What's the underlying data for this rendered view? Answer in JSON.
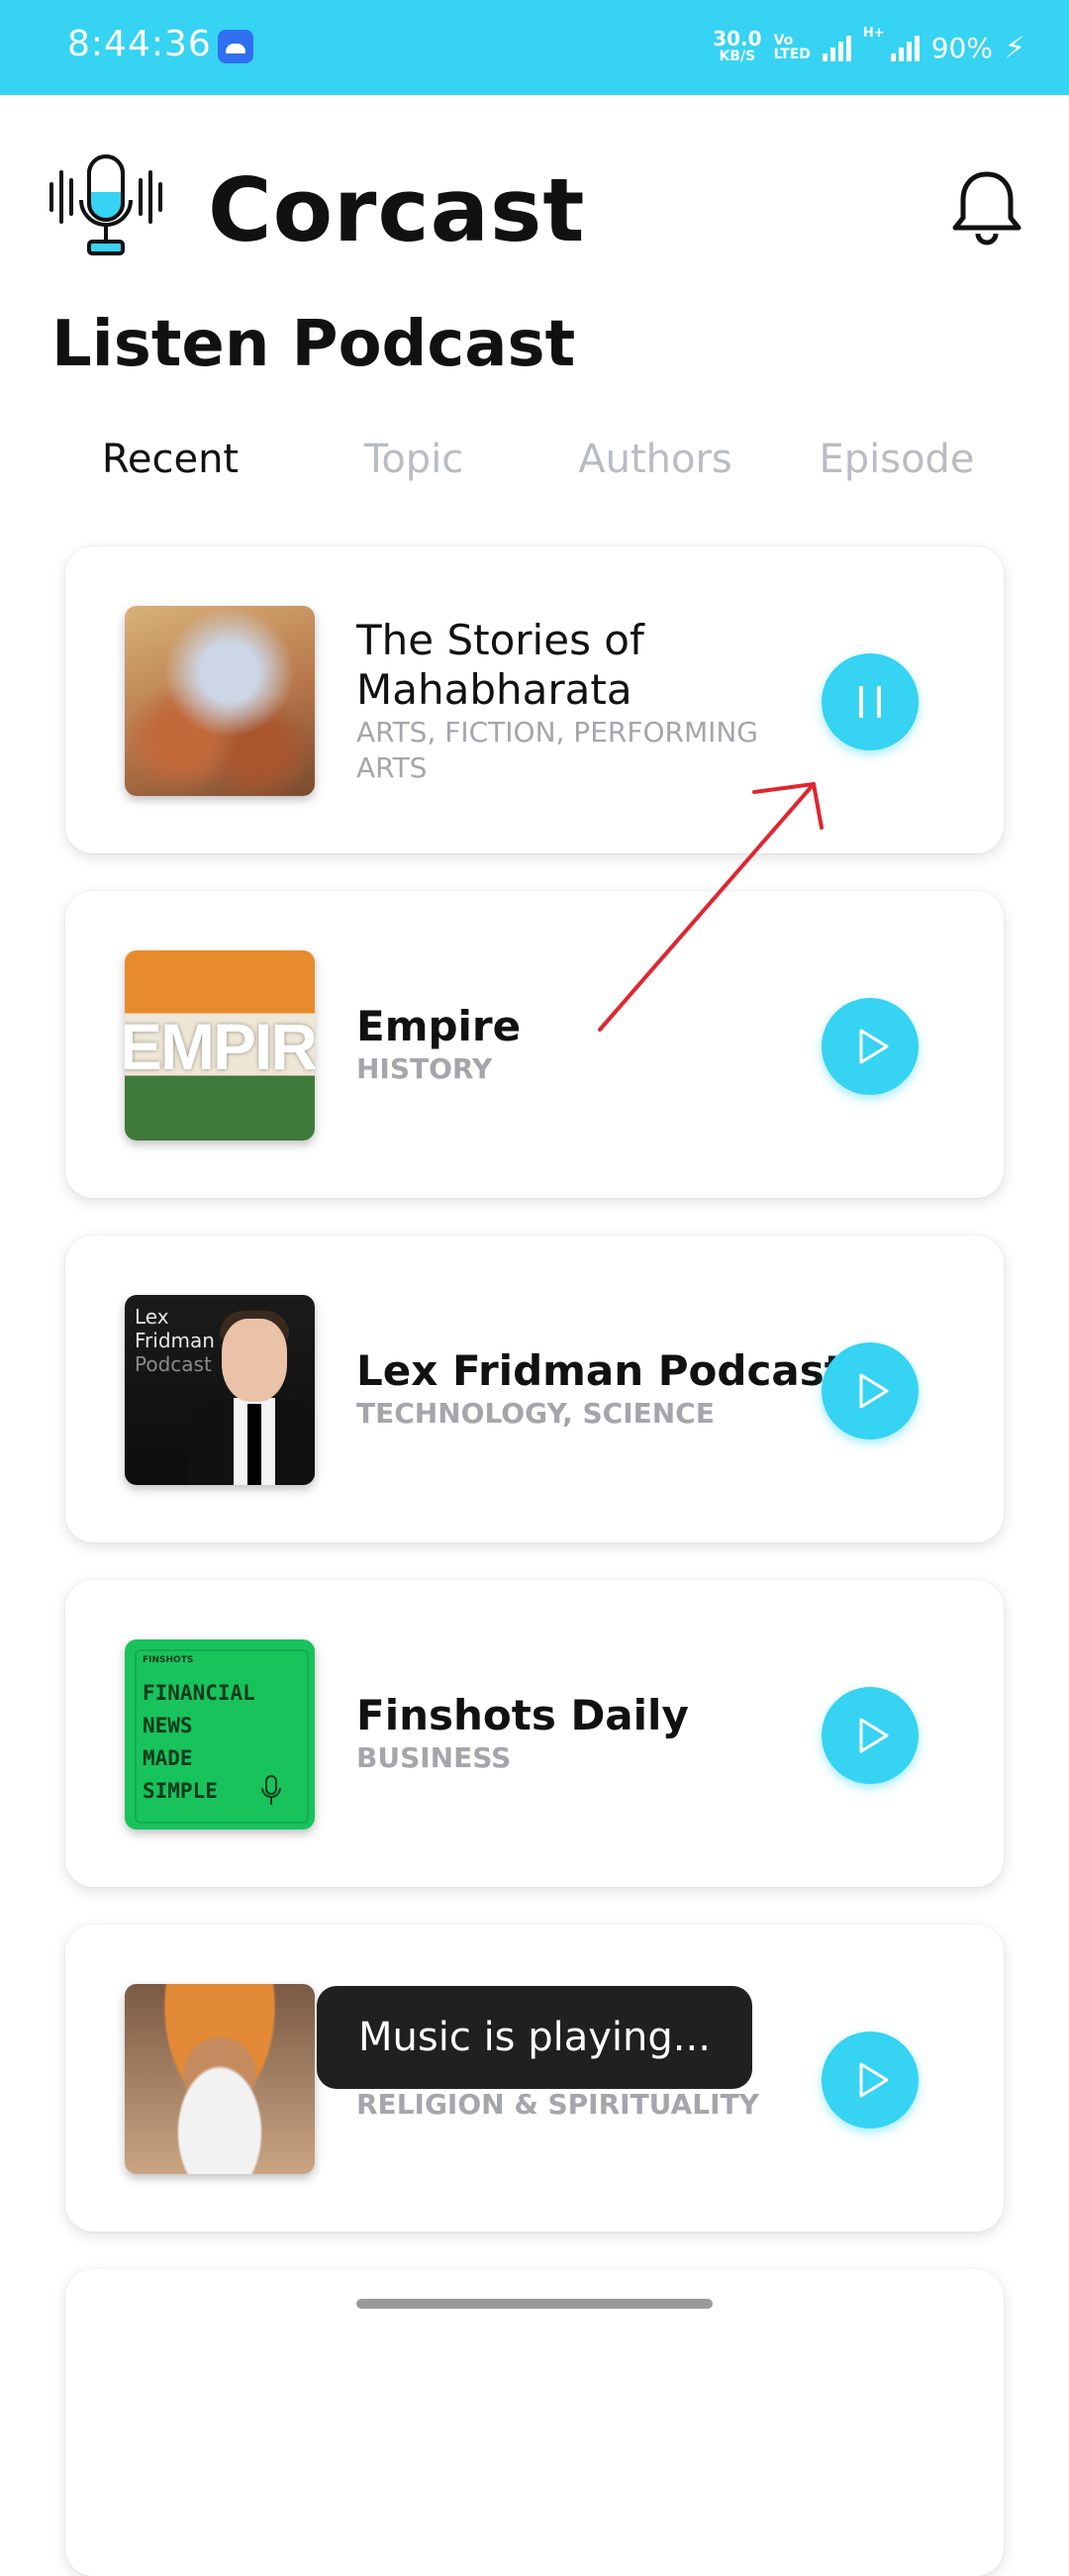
{
  "status_bar": {
    "time": "8:44:36",
    "net_speed": "30.0",
    "net_speed_unit": "KB/S",
    "volte_top": "Vo",
    "volte_bottom": "LTED",
    "network_type": "H+",
    "battery": "90%"
  },
  "header": {
    "app_title": "Corcast",
    "section_title": "Listen Podcast"
  },
  "tabs": [
    {
      "label": "Recent",
      "active": true
    },
    {
      "label": "Topic",
      "active": false
    },
    {
      "label": "Authors",
      "active": false
    },
    {
      "label": "Episode",
      "active": false
    }
  ],
  "podcasts": [
    {
      "title_line1": "The Stories of",
      "title_line2": "Mahabharata",
      "category_line1": "ARTS, FICTION, PERFORMING",
      "category_line2": "ARTS",
      "state": "playing",
      "button_icon": "pause-icon"
    },
    {
      "title": "Empire",
      "category": "HISTORY",
      "cover_text": "EMPIRE",
      "state": "paused",
      "button_icon": "play-icon"
    },
    {
      "title": "Lex Fridman Podcast",
      "category": "TECHNOLOGY, SCIENCE",
      "cover_line1": "Lex",
      "cover_line2": "Fridman",
      "cover_line3": "Podcast",
      "state": "paused",
      "button_icon": "play-icon"
    },
    {
      "title": "Finshots Daily",
      "category": "BUSINESS",
      "cover_brand": "FINSHOTS",
      "cover_lines": [
        "FINANCIAL",
        "NEWS",
        "MADE",
        "SIMPLE"
      ],
      "state": "paused",
      "button_icon": "play-icon"
    },
    {
      "title": "",
      "category": "RELIGION & SPIRITUALITY",
      "state": "paused",
      "button_icon": "play-icon"
    }
  ],
  "toast": {
    "message": "Music is playing..."
  },
  "colors": {
    "accent": "#36d3f2",
    "status_bar": "#36d3f2",
    "annotation": "#e0262f"
  }
}
